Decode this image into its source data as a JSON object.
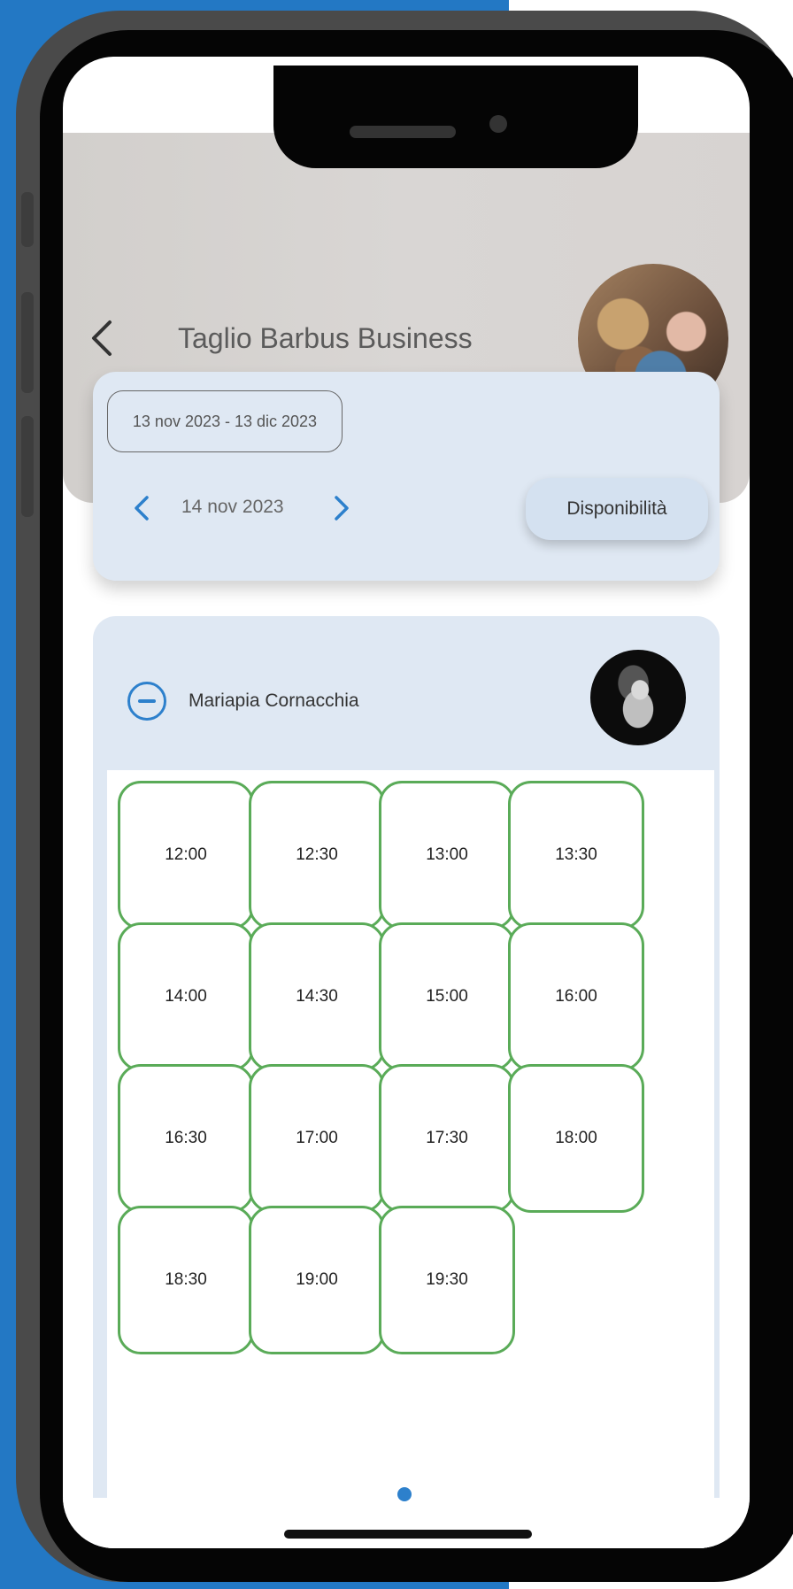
{
  "app": {
    "title": "Taglio Barbus Business",
    "accent_color": "#2d80cc",
    "slot_border_color": "#5aab58"
  },
  "date_selector": {
    "range": "13 nov 2023 - 13 dic 2023",
    "current_day": "14 nov 2023",
    "availability_button": "Disponibilità"
  },
  "staff": {
    "name": "Mariapia Cornacchia",
    "avatar_icon": "staff-photo"
  },
  "slots": [
    "12:00",
    "12:30",
    "13:00",
    "13:30",
    "14:00",
    "14:30",
    "15:00",
    "16:00",
    "16:30",
    "17:00",
    "17:30",
    "18:00",
    "18:30",
    "19:00",
    "19:30"
  ],
  "icons": {
    "back": "chevron-left-icon",
    "prev_day": "chevron-left-icon",
    "next_day": "chevron-right-icon",
    "collapse": "minus-circle-icon"
  }
}
